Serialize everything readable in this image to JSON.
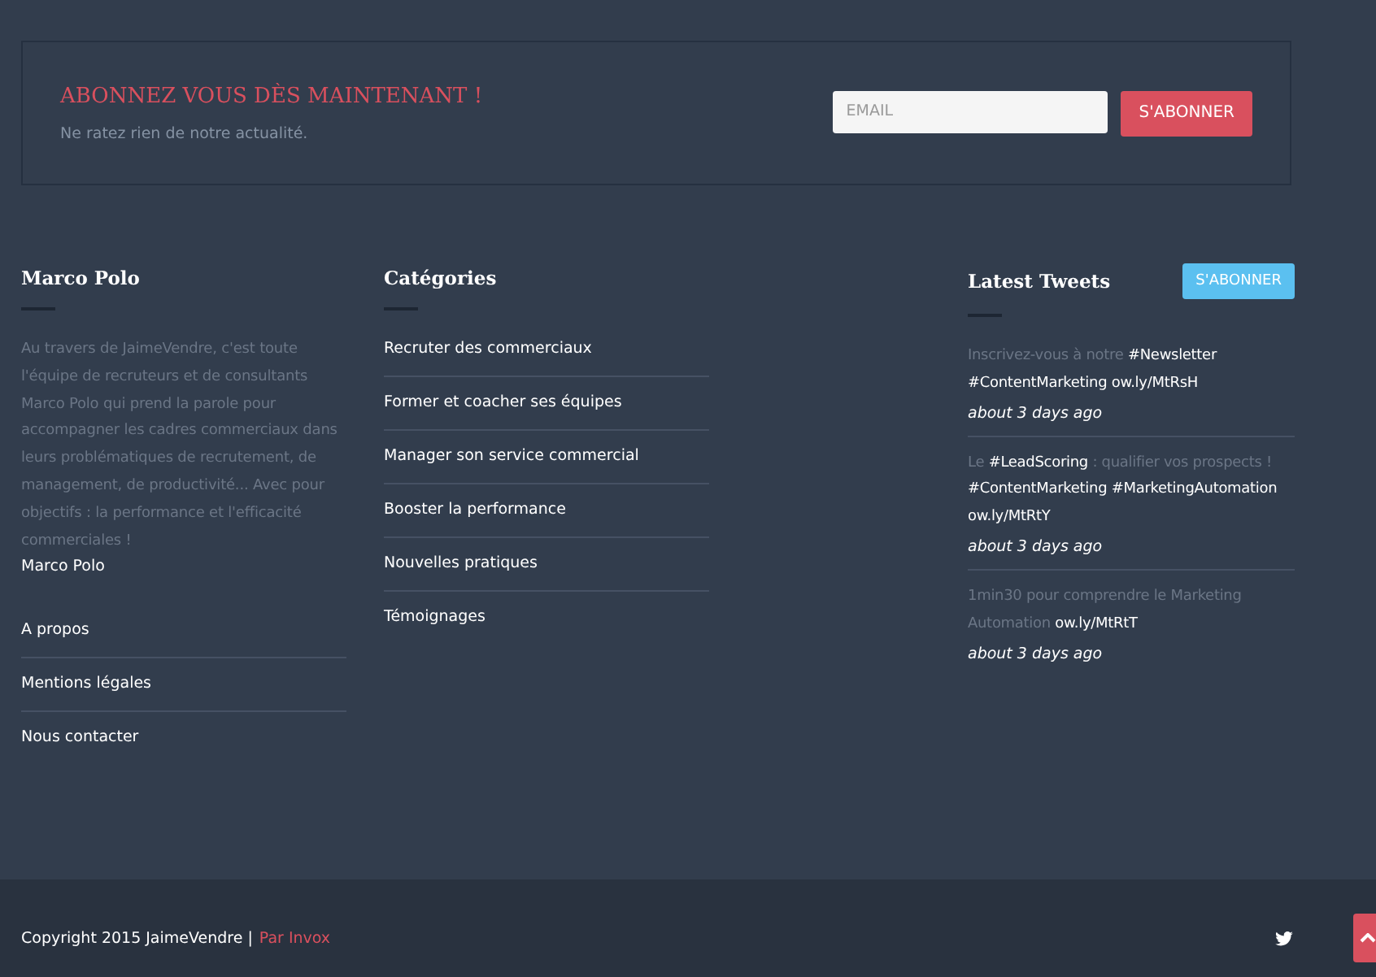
{
  "subscribe": {
    "title": "ABONNEZ VOUS DÈS MAINTENANT !",
    "subtitle": "Ne ratez rien de notre actualité.",
    "email": {
      "placeholder": "EMAIL"
    },
    "button": "S'ABONNER"
  },
  "about": {
    "title": "Marco Polo",
    "text": "Au travers de JaimeVendre, c'est toute l'équipe de recruteurs et de consultants Marco Polo qui prend la parole pour accompagner les cadres commerciaux dans leurs problématiques de recrutement, de management, de productivité... Avec pour objectifs : la performance et l'efficacité commerciales !",
    "author": "Marco Polo",
    "links": [
      "A propos",
      "Mentions légales",
      "Nous contacter"
    ]
  },
  "categories": {
    "title": "Catégories",
    "items": [
      "Recruter des commerciaux",
      "Former et coacher ses équipes",
      "Manager son service commercial",
      "Booster la performance",
      "Nouvelles pratiques",
      "Témoignages"
    ]
  },
  "tweets": {
    "title": "Latest Tweets",
    "button": "S'ABONNER",
    "items": [
      {
        "parts": [
          {
            "kind": "text",
            "text": "Inscrivez-vous à notre"
          },
          {
            "kind": "link",
            "text": "#Newsletter"
          },
          {
            "kind": "link",
            "text": "#ContentMarketing"
          },
          {
            "kind": "link",
            "text": "ow.ly/MtRsH"
          }
        ],
        "time": "about 3 days ago"
      },
      {
        "parts": [
          {
            "kind": "text",
            "text": "Le"
          },
          {
            "kind": "link",
            "text": "#LeadScoring"
          },
          {
            "kind": "text",
            "text": ": qualifier vos prospects !"
          },
          {
            "kind": "link",
            "text": "#ContentMarketing"
          },
          {
            "kind": "link",
            "text": "#MarketingAutomation"
          },
          {
            "kind": "link",
            "text": "ow.ly/MtRtY"
          }
        ],
        "time": "about 3 days ago"
      },
      {
        "parts": [
          {
            "kind": "text",
            "text": "1min30 pour comprendre le Marketing Automation"
          },
          {
            "kind": "link",
            "text": "ow.ly/MtRtT"
          }
        ],
        "time": "about 3 days ago"
      }
    ]
  },
  "footer": {
    "copyright": "Copyright 2015 JaimeVendre |",
    "credit": "Par Invox"
  }
}
